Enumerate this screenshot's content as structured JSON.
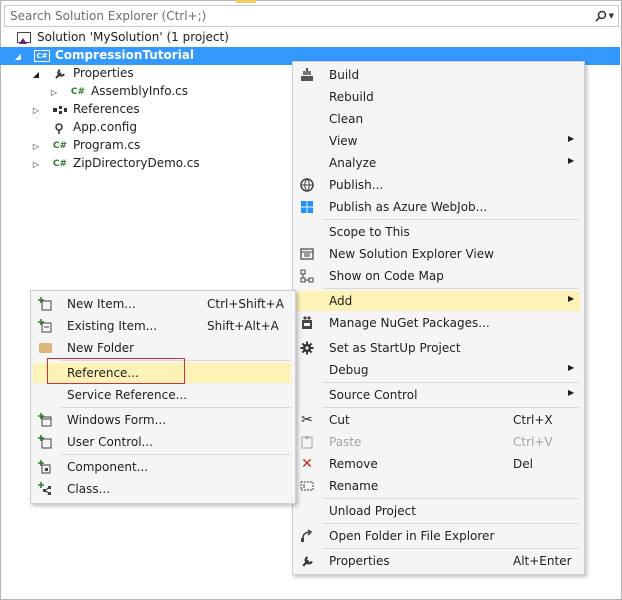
{
  "search": {
    "placeholder": "Search Solution Explorer (Ctrl+;)"
  },
  "tree": [
    {
      "label": "Solution 'MySolution' (1 project)",
      "icon": "solution-icon"
    },
    {
      "label": "CompressionTutorial",
      "icon": "csharp-project-icon",
      "selected": true
    },
    {
      "label": "Properties",
      "icon": "wrench-icon"
    },
    {
      "label": "AssemblyInfo.cs",
      "icon": "csharp-file-icon"
    },
    {
      "label": "References",
      "icon": "references-icon"
    },
    {
      "label": "App.config",
      "icon": "config-file-icon"
    },
    {
      "label": "Program.cs",
      "icon": "csharp-file-icon"
    },
    {
      "label": "ZipDirectoryDemo.cs",
      "icon": "csharp-file-icon"
    }
  ],
  "context_menu": {
    "items": [
      {
        "label": "Build",
        "icon": "build-icon"
      },
      {
        "label": "Rebuild"
      },
      {
        "label": "Clean"
      },
      {
        "label": "View",
        "submenu": true
      },
      {
        "label": "Analyze",
        "submenu": true
      },
      {
        "label": "Publish...",
        "icon": "publish-globe-icon"
      },
      {
        "label": "Publish as Azure WebJob...",
        "icon": "azure-windows-icon"
      },
      {
        "label": "Scope to This"
      },
      {
        "label": "New Solution Explorer View",
        "icon": "new-view-icon"
      },
      {
        "label": "Show on Code Map",
        "icon": "code-map-icon"
      },
      {
        "label": "Add",
        "submenu": true,
        "highlighted": true
      },
      {
        "label": "Manage NuGet Packages...",
        "icon": "nuget-icon"
      },
      {
        "label": "Set as StartUp Project",
        "icon": "gear-icon"
      },
      {
        "label": "Debug",
        "submenu": true
      },
      {
        "label": "Source Control",
        "submenu": true
      },
      {
        "label": "Cut",
        "shortcut": "Ctrl+X",
        "icon": "scissors-icon"
      },
      {
        "label": "Paste",
        "shortcut": "Ctrl+V",
        "icon": "paste-icon",
        "disabled": true
      },
      {
        "label": "Remove",
        "shortcut": "Del",
        "icon": "remove-x-icon"
      },
      {
        "label": "Rename",
        "icon": "rename-icon"
      },
      {
        "label": "Unload Project"
      },
      {
        "label": "Open Folder in File Explorer",
        "icon": "open-folder-arrow-icon"
      },
      {
        "label": "Properties",
        "shortcut": "Alt+Enter",
        "icon": "wrench-icon"
      }
    ]
  },
  "add_submenu": {
    "items": [
      {
        "label": "New Item...",
        "shortcut": "Ctrl+Shift+A",
        "icon": "new-item-icon"
      },
      {
        "label": "Existing Item...",
        "shortcut": "Shift+Alt+A",
        "icon": "existing-item-icon"
      },
      {
        "label": "New Folder",
        "icon": "new-folder-icon"
      },
      {
        "label": "Reference...",
        "highlighted": true
      },
      {
        "label": "Service Reference..."
      },
      {
        "label": "Windows Form...",
        "icon": "windows-form-icon"
      },
      {
        "label": "User Control...",
        "icon": "user-control-icon"
      },
      {
        "label": "Component...",
        "icon": "component-icon"
      },
      {
        "label": "Class...",
        "icon": "class-icon"
      }
    ]
  },
  "colors": {
    "selection": "#3399ff",
    "menu_highlight": "#fef3b7",
    "menu_background": "#f5f5f5",
    "reference_outline": "#c8323c",
    "csharp_green": "#2f7d2f"
  }
}
